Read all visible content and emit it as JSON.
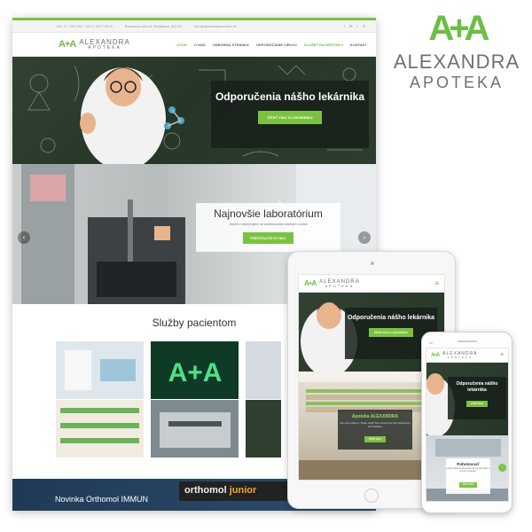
{
  "brand": {
    "mark": "A+A",
    "name": "ALEXANDRA",
    "sub": "APOTEKA"
  },
  "desktop": {
    "topbar": {
      "phone": "+421 37 733 000, +421 2 2077 5219",
      "address": "Rázusova ulica 6, Bratislava, 811 02",
      "email": "info@apotekaalexandra.sk",
      "social": "f ✉ t ⊡"
    },
    "logo": {
      "mark": "A+A",
      "line1": "ALEXANDRA",
      "line2": "APOTEKA"
    },
    "menu": [
      {
        "label": "ÚVOD",
        "active": true
      },
      {
        "label": "O NÁS",
        "active": false
      },
      {
        "label": "ODBORNÁ STRÁNKA",
        "active": false
      },
      {
        "label": "ODPORÚČANIE LIEKOV",
        "active": false
      },
      {
        "label": "SLUŽBY PACIENTOM ▾",
        "active": true
      },
      {
        "label": "KONTAKT",
        "active": false
      }
    ],
    "hero": {
      "title": "Odporučenia nášho lekárnika",
      "button": "ČÍTAŤ VIAC O LEKÁRNIKU"
    },
    "lab": {
      "title": "Najnovšie laboratórium",
      "subtitle": "Jediné v našej krajine na kombinovanie lokálnych zložiek",
      "button": "PREČÍTAJTE SI VIAC",
      "prev": "‹",
      "next": "›"
    },
    "services": {
      "title": "Služby pacientom"
    },
    "promo": {
      "title": "Novinka Orthomol IMMUN",
      "brand1": "orthomol",
      "brand2": "junior"
    }
  },
  "tablet": {
    "logo": {
      "mark": "A+A",
      "line1": "ALEXANDRA",
      "line2": "APOTEKA"
    },
    "menu_icon": "≡",
    "hero": {
      "title": "Odporučenia nášho lekárnika",
      "button": "ČÍTAŤ VIAC O LEKÁRNIKU"
    },
    "shop": {
      "title": "Apoteka ALEXANDRA",
      "subtitle": "Akú výzvu lekárne v Trnave zvolili? Sme otvorení pre Vás v doplnených 24/7 službách.",
      "button": "ČÍTAŤ VIAC"
    }
  },
  "phone": {
    "brand_label": "MI",
    "logo": {
      "mark": "A+A",
      "line1": "ALEXANDRA",
      "line2": "APOTEKA"
    },
    "menu_icon": "≡",
    "hero": {
      "title": "Odporučenia nášho lekárnika",
      "button": "ČÍTAŤ VIAC"
    },
    "shop": {
      "title": "Pohotovosť",
      "subtitle": "Lekáreň Apoteka Alexandra má pre Vás službu v nočných hodinách.",
      "button": "ČÍTAŤ VIAC",
      "next": "›"
    }
  },
  "colors": {
    "accent": "#7cc242",
    "logo_green": "#6cbe45",
    "logo_gray": "#707070",
    "chalkboard": "#2c3d2e",
    "promo_blue": "#1f3a57"
  }
}
